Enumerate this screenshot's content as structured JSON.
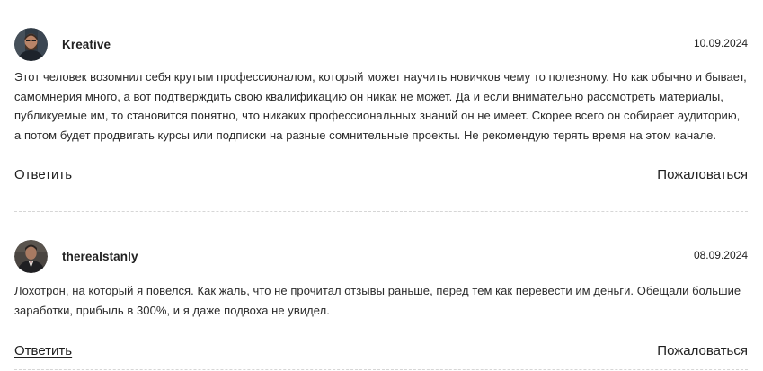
{
  "comments": [
    {
      "author": "Kreative",
      "date": "10.09.2024",
      "text": "Этот человек возомнил себя крутым профессионалом, который может научить новичков чему то полезному. Но как обычно и бывает, самомнерия много, а вот подтверждить свою квалификацию он никак не может. Да и если внимательно рассмотреть материалы, публикуемые им, то становится понятно, что никаких профессиональных знаний он не имеет. Скорее всего он собирает аудиторию, а потом будет продвигать курсы или подписки на разные сомнительные проекты. Не рекомендую терять время на этом канале.",
      "reply_label": "Ответить",
      "report_label": "Пожаловаться",
      "avatar_icon": "user-photo-bearded-man"
    },
    {
      "author": "therealstanly",
      "date": "08.09.2024",
      "text": "Лохотрон, на который я повелся. Как жаль, что не прочитал отзывы раньше, перед тем как перевести им деньги. Обещали большие заработки, прибыль в 300%, и я даже подвоха не увидел.",
      "reply_label": "Ответить",
      "report_label": "Пожаловаться",
      "avatar_icon": "user-photo-man-in-suit"
    }
  ]
}
